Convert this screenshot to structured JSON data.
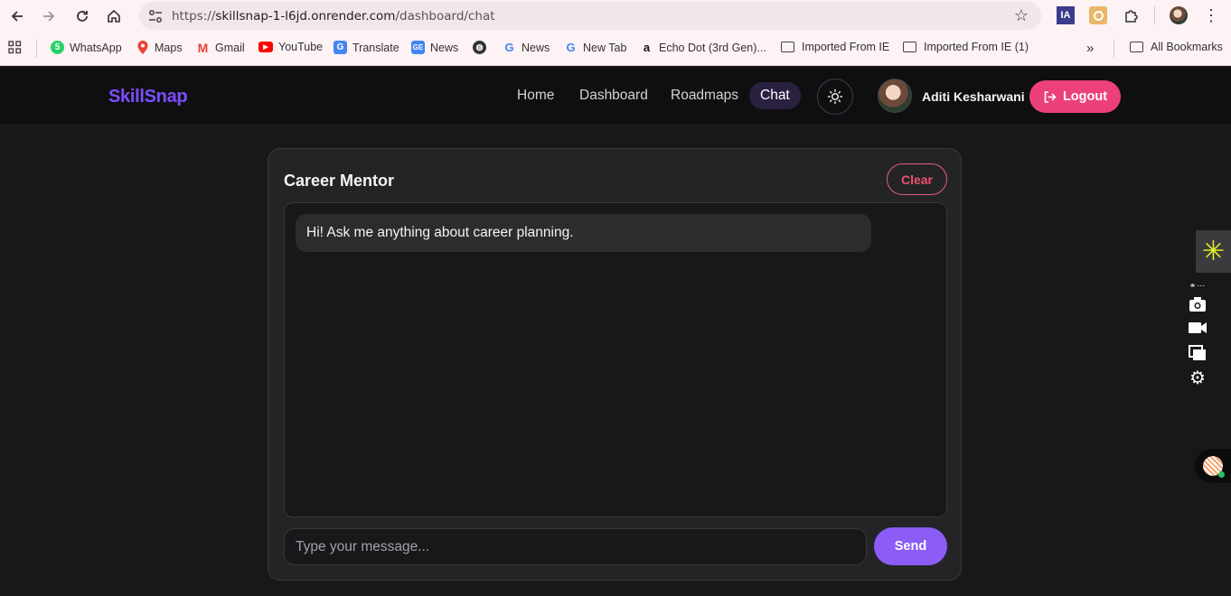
{
  "browser": {
    "url_prefix": "https://",
    "url_host": "skillsnap-1-l6jd.onrender.com",
    "url_path": "/dashboard/chat",
    "ext_ia_label": "IA",
    "bookmarks": [
      {
        "label": "WhatsApp",
        "icon": "whatsapp-icon",
        "color": "#25d366"
      },
      {
        "label": "Maps",
        "icon": "maps-icon",
        "color": "#34a853"
      },
      {
        "label": "Gmail",
        "icon": "gmail-icon",
        "color": "#ea4335"
      },
      {
        "label": "YouTube",
        "icon": "youtube-icon",
        "color": "#ff0000"
      },
      {
        "label": "Translate",
        "icon": "translate-icon",
        "color": "#4285f4"
      },
      {
        "label": "News",
        "icon": "google-news-icon",
        "color": "#4285f4"
      },
      {
        "label": "",
        "icon": "globe-icon",
        "color": "#333333"
      },
      {
        "label": "News",
        "icon": "google-icon",
        "color": "#4285f4"
      },
      {
        "label": "New Tab",
        "icon": "google-icon",
        "color": "#4285f4"
      },
      {
        "label": "Echo Dot (3rd Gen)...",
        "icon": "amazon-icon",
        "color": "#111111"
      },
      {
        "label": "Imported From IE",
        "icon": "folder-icon"
      },
      {
        "label": "Imported From IE (1)",
        "icon": "folder-icon"
      }
    ],
    "overflow_label": "»",
    "all_bookmarks_label": "All Bookmarks"
  },
  "app": {
    "brand": "SkillSnap",
    "nav": [
      "Home",
      "Dashboard",
      "Roadmaps",
      "Chat"
    ],
    "active_nav": "Chat",
    "user_name": "Aditi Kesharwani",
    "logout_label": "Logout",
    "accent_color": "#8b5cf6",
    "logout_color": "#ec407a"
  },
  "chat": {
    "title": "Career Mentor",
    "clear_label": "Clear",
    "messages": [
      {
        "role": "assistant",
        "text": "Hi! Ask me anything about career planning."
      }
    ],
    "input_placeholder": "Type your message...",
    "send_label": "Send"
  }
}
